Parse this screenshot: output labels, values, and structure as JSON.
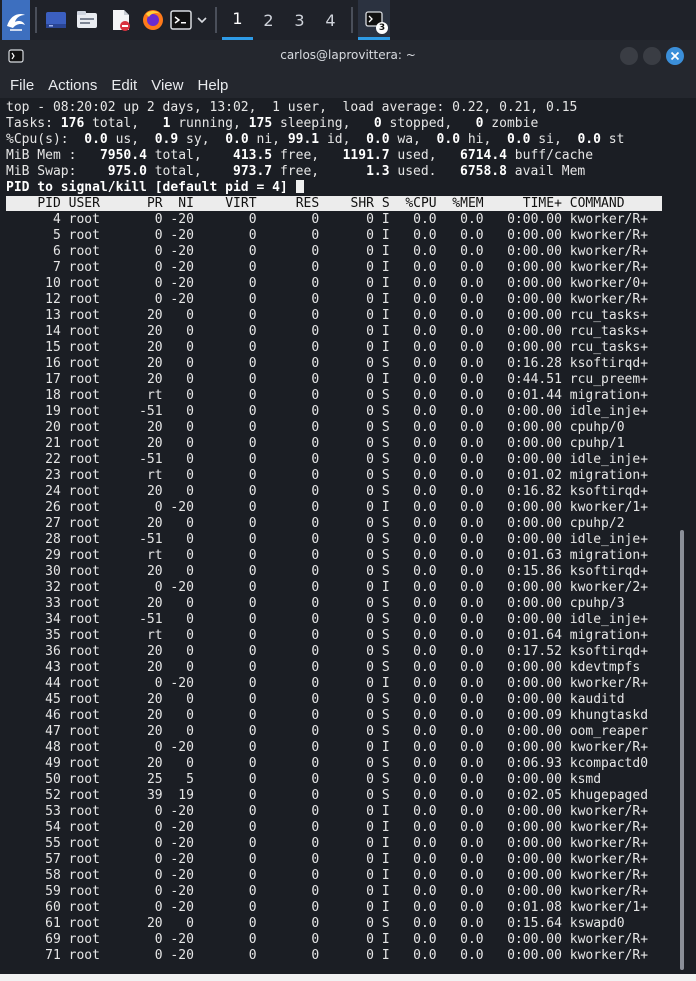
{
  "taskbar": {
    "workspaces": [
      "1",
      "2",
      "3",
      "4"
    ],
    "active_workspace": "1",
    "terminal_badge": "3",
    "icons": [
      "kali-menu-icon",
      "desktop-icon",
      "file-manager-icon",
      "text-editor-icon",
      "firefox-icon",
      "terminal-icon",
      "chevron-down-icon"
    ]
  },
  "window": {
    "title": "carlos@laprovittera: ~",
    "buttons": [
      "minimize",
      "maximize",
      "close"
    ]
  },
  "menu": [
    "File",
    "Actions",
    "Edit",
    "View",
    "Help"
  ],
  "top": {
    "line1": "top - 08:20:02 up 2 days, 13:02,  1 user,  load average: 0.22, 0.21, 0.15",
    "tasks": {
      "label": "Tasks:",
      "total": "176",
      "running": "1",
      "sleeping": "175",
      "stopped": "0",
      "zombie": "0"
    },
    "cpu": {
      "label": "%Cpu(s):",
      "us": "0.0",
      "sy": "0.9",
      "ni": "0.0",
      "id": "99.1",
      "wa": "0.0",
      "hi": "0.0",
      "si": "0.0",
      "st": "0.0"
    },
    "mem": {
      "label": "MiB Mem :",
      "total": "7950.4",
      "free": "413.5",
      "used": "1191.7",
      "buff_cache": "6714.4"
    },
    "swap": {
      "label": "MiB Swap:",
      "total": "975.0",
      "free": "973.7",
      "used": "1.3",
      "avail": "6758.8"
    },
    "prompt": "PID to signal/kill [default pid = 4] ",
    "columns": [
      "PID",
      "USER",
      "PR",
      "NI",
      "VIRT",
      "RES",
      "SHR",
      "S",
      "%CPU",
      "%MEM",
      "TIME+",
      "COMMAND"
    ],
    "processes": [
      [
        "4",
        "root",
        "0",
        "-20",
        "0",
        "0",
        "0",
        "I",
        "0.0",
        "0.0",
        "0:00.00",
        "kworker/R+"
      ],
      [
        "5",
        "root",
        "0",
        "-20",
        "0",
        "0",
        "0",
        "I",
        "0.0",
        "0.0",
        "0:00.00",
        "kworker/R+"
      ],
      [
        "6",
        "root",
        "0",
        "-20",
        "0",
        "0",
        "0",
        "I",
        "0.0",
        "0.0",
        "0:00.00",
        "kworker/R+"
      ],
      [
        "7",
        "root",
        "0",
        "-20",
        "0",
        "0",
        "0",
        "I",
        "0.0",
        "0.0",
        "0:00.00",
        "kworker/R+"
      ],
      [
        "10",
        "root",
        "0",
        "-20",
        "0",
        "0",
        "0",
        "I",
        "0.0",
        "0.0",
        "0:00.00",
        "kworker/0+"
      ],
      [
        "12",
        "root",
        "0",
        "-20",
        "0",
        "0",
        "0",
        "I",
        "0.0",
        "0.0",
        "0:00.00",
        "kworker/R+"
      ],
      [
        "13",
        "root",
        "20",
        "0",
        "0",
        "0",
        "0",
        "I",
        "0.0",
        "0.0",
        "0:00.00",
        "rcu_tasks+"
      ],
      [
        "14",
        "root",
        "20",
        "0",
        "0",
        "0",
        "0",
        "I",
        "0.0",
        "0.0",
        "0:00.00",
        "rcu_tasks+"
      ],
      [
        "15",
        "root",
        "20",
        "0",
        "0",
        "0",
        "0",
        "I",
        "0.0",
        "0.0",
        "0:00.00",
        "rcu_tasks+"
      ],
      [
        "16",
        "root",
        "20",
        "0",
        "0",
        "0",
        "0",
        "S",
        "0.0",
        "0.0",
        "0:16.28",
        "ksoftirqd+"
      ],
      [
        "17",
        "root",
        "20",
        "0",
        "0",
        "0",
        "0",
        "I",
        "0.0",
        "0.0",
        "0:44.51",
        "rcu_preem+"
      ],
      [
        "18",
        "root",
        "rt",
        "0",
        "0",
        "0",
        "0",
        "S",
        "0.0",
        "0.0",
        "0:01.44",
        "migration+"
      ],
      [
        "19",
        "root",
        "-51",
        "0",
        "0",
        "0",
        "0",
        "S",
        "0.0",
        "0.0",
        "0:00.00",
        "idle_inje+"
      ],
      [
        "20",
        "root",
        "20",
        "0",
        "0",
        "0",
        "0",
        "S",
        "0.0",
        "0.0",
        "0:00.00",
        "cpuhp/0"
      ],
      [
        "21",
        "root",
        "20",
        "0",
        "0",
        "0",
        "0",
        "S",
        "0.0",
        "0.0",
        "0:00.00",
        "cpuhp/1"
      ],
      [
        "22",
        "root",
        "-51",
        "0",
        "0",
        "0",
        "0",
        "S",
        "0.0",
        "0.0",
        "0:00.00",
        "idle_inje+"
      ],
      [
        "23",
        "root",
        "rt",
        "0",
        "0",
        "0",
        "0",
        "S",
        "0.0",
        "0.0",
        "0:01.02",
        "migration+"
      ],
      [
        "24",
        "root",
        "20",
        "0",
        "0",
        "0",
        "0",
        "S",
        "0.0",
        "0.0",
        "0:16.82",
        "ksoftirqd+"
      ],
      [
        "26",
        "root",
        "0",
        "-20",
        "0",
        "0",
        "0",
        "I",
        "0.0",
        "0.0",
        "0:00.00",
        "kworker/1+"
      ],
      [
        "27",
        "root",
        "20",
        "0",
        "0",
        "0",
        "0",
        "S",
        "0.0",
        "0.0",
        "0:00.00",
        "cpuhp/2"
      ],
      [
        "28",
        "root",
        "-51",
        "0",
        "0",
        "0",
        "0",
        "S",
        "0.0",
        "0.0",
        "0:00.00",
        "idle_inje+"
      ],
      [
        "29",
        "root",
        "rt",
        "0",
        "0",
        "0",
        "0",
        "S",
        "0.0",
        "0.0",
        "0:01.63",
        "migration+"
      ],
      [
        "30",
        "root",
        "20",
        "0",
        "0",
        "0",
        "0",
        "S",
        "0.0",
        "0.0",
        "0:15.86",
        "ksoftirqd+"
      ],
      [
        "32",
        "root",
        "0",
        "-20",
        "0",
        "0",
        "0",
        "I",
        "0.0",
        "0.0",
        "0:00.00",
        "kworker/2+"
      ],
      [
        "33",
        "root",
        "20",
        "0",
        "0",
        "0",
        "0",
        "S",
        "0.0",
        "0.0",
        "0:00.00",
        "cpuhp/3"
      ],
      [
        "34",
        "root",
        "-51",
        "0",
        "0",
        "0",
        "0",
        "S",
        "0.0",
        "0.0",
        "0:00.00",
        "idle_inje+"
      ],
      [
        "35",
        "root",
        "rt",
        "0",
        "0",
        "0",
        "0",
        "S",
        "0.0",
        "0.0",
        "0:01.64",
        "migration+"
      ],
      [
        "36",
        "root",
        "20",
        "0",
        "0",
        "0",
        "0",
        "S",
        "0.0",
        "0.0",
        "0:17.52",
        "ksoftirqd+"
      ],
      [
        "43",
        "root",
        "20",
        "0",
        "0",
        "0",
        "0",
        "S",
        "0.0",
        "0.0",
        "0:00.00",
        "kdevtmpfs"
      ],
      [
        "44",
        "root",
        "0",
        "-20",
        "0",
        "0",
        "0",
        "I",
        "0.0",
        "0.0",
        "0:00.00",
        "kworker/R+"
      ],
      [
        "45",
        "root",
        "20",
        "0",
        "0",
        "0",
        "0",
        "S",
        "0.0",
        "0.0",
        "0:00.00",
        "kauditd"
      ],
      [
        "46",
        "root",
        "20",
        "0",
        "0",
        "0",
        "0",
        "S",
        "0.0",
        "0.0",
        "0:00.09",
        "khungtaskd"
      ],
      [
        "47",
        "root",
        "20",
        "0",
        "0",
        "0",
        "0",
        "S",
        "0.0",
        "0.0",
        "0:00.00",
        "oom_reaper"
      ],
      [
        "48",
        "root",
        "0",
        "-20",
        "0",
        "0",
        "0",
        "I",
        "0.0",
        "0.0",
        "0:00.00",
        "kworker/R+"
      ],
      [
        "49",
        "root",
        "20",
        "0",
        "0",
        "0",
        "0",
        "S",
        "0.0",
        "0.0",
        "0:06.93",
        "kcompactd0"
      ],
      [
        "50",
        "root",
        "25",
        "5",
        "0",
        "0",
        "0",
        "S",
        "0.0",
        "0.0",
        "0:00.00",
        "ksmd"
      ],
      [
        "52",
        "root",
        "39",
        "19",
        "0",
        "0",
        "0",
        "S",
        "0.0",
        "0.0",
        "0:02.05",
        "khugepaged"
      ],
      [
        "53",
        "root",
        "0",
        "-20",
        "0",
        "0",
        "0",
        "I",
        "0.0",
        "0.0",
        "0:00.00",
        "kworker/R+"
      ],
      [
        "54",
        "root",
        "0",
        "-20",
        "0",
        "0",
        "0",
        "I",
        "0.0",
        "0.0",
        "0:00.00",
        "kworker/R+"
      ],
      [
        "55",
        "root",
        "0",
        "-20",
        "0",
        "0",
        "0",
        "I",
        "0.0",
        "0.0",
        "0:00.00",
        "kworker/R+"
      ],
      [
        "57",
        "root",
        "0",
        "-20",
        "0",
        "0",
        "0",
        "I",
        "0.0",
        "0.0",
        "0:00.00",
        "kworker/R+"
      ],
      [
        "58",
        "root",
        "0",
        "-20",
        "0",
        "0",
        "0",
        "I",
        "0.0",
        "0.0",
        "0:00.00",
        "kworker/R+"
      ],
      [
        "59",
        "root",
        "0",
        "-20",
        "0",
        "0",
        "0",
        "I",
        "0.0",
        "0.0",
        "0:00.00",
        "kworker/R+"
      ],
      [
        "60",
        "root",
        "0",
        "-20",
        "0",
        "0",
        "0",
        "I",
        "0.0",
        "0.0",
        "0:01.08",
        "kworker/1+"
      ],
      [
        "61",
        "root",
        "20",
        "0",
        "0",
        "0",
        "0",
        "S",
        "0.0",
        "0.0",
        "0:15.64",
        "kswapd0"
      ],
      [
        "69",
        "root",
        "0",
        "-20",
        "0",
        "0",
        "0",
        "I",
        "0.0",
        "0.0",
        "0:00.00",
        "kworker/R+"
      ],
      [
        "71",
        "root",
        "0",
        "-20",
        "0",
        "0",
        "0",
        "I",
        "0.0",
        "0.0",
        "0:00.00",
        "kworker/R+"
      ]
    ]
  },
  "colors": {
    "terminal_bg": "#1b1e24",
    "accent": "#2e9be6",
    "close_button": "#3b8fd9"
  }
}
